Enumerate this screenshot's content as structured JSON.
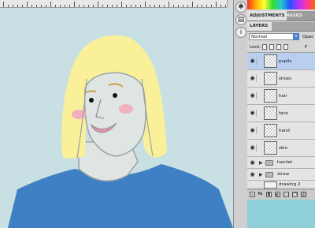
{
  "colors": {
    "canvas_bg": "#c8e0e3",
    "hair": "#fbf09a",
    "skin": "#dfe5e2",
    "shirt": "#3f7fc4",
    "blush": "#f3aebf",
    "mouth": "#e88ea8",
    "panel_selected": "#b9cff0"
  },
  "toolstrip": {
    "icons": [
      "brush-preset-icon",
      "layer-comps-icon",
      "info-icon"
    ]
  },
  "panel": {
    "adjustments_tab": "ADJUSTMENTS",
    "masks_tab": "MASKS",
    "layers_tab": "LAYERS",
    "blend_mode": "Normal",
    "opacity_label": "Opac",
    "lock_label": "Lock:",
    "fill_label": "F",
    "layers": [
      {
        "name": "pupils",
        "type": "layer",
        "selected": true
      },
      {
        "name": "shoes",
        "type": "layer",
        "selected": false
      },
      {
        "name": "hair",
        "type": "layer",
        "selected": false
      },
      {
        "name": "face",
        "type": "layer",
        "selected": false
      },
      {
        "name": "hand",
        "type": "layer",
        "selected": false
      },
      {
        "name": "skin",
        "type": "layer",
        "selected": false
      },
      {
        "name": "hamlet",
        "type": "group",
        "selected": false
      },
      {
        "name": "straw",
        "type": "group",
        "selected": false
      },
      {
        "name": "drawing 2",
        "type": "layer",
        "selected": false
      }
    ],
    "bottom_icons": [
      "link-icon",
      "fx-icon",
      "mask-icon",
      "adjustment-icon",
      "folder-icon",
      "new-layer-icon",
      "trash-icon"
    ]
  }
}
